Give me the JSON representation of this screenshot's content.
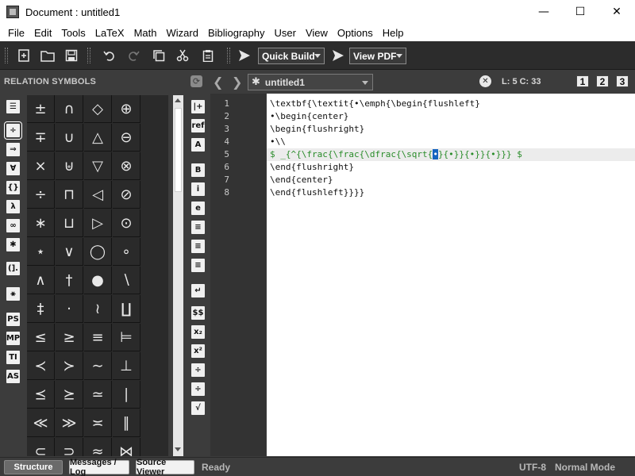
{
  "window": {
    "title": "Document : untitled1",
    "minimize": "—",
    "maximize": "☐",
    "close": "✕"
  },
  "menu": [
    "File",
    "Edit",
    "Tools",
    "LaTeX",
    "Math",
    "Wizard",
    "Bibliography",
    "User",
    "View",
    "Options",
    "Help"
  ],
  "toolbar": {
    "quick_build": "Quick Build",
    "view_pdf": "View PDF"
  },
  "panel": {
    "title": "RELATION SYMBOLS",
    "categories": [
      "☰",
      "÷",
      "⇒",
      "∀",
      "{}",
      "λ",
      "∞",
      "✱",
      "(].",
      "⚹",
      "PS",
      "MP",
      "TI",
      "AS"
    ]
  },
  "symbols": [
    [
      "±",
      "∩",
      "◇",
      "⊕"
    ],
    [
      "∓",
      "∪",
      "△",
      "⊖"
    ],
    [
      "×",
      "⊎",
      "▽",
      "⊗"
    ],
    [
      "÷",
      "⊓",
      "◁",
      "⊘"
    ],
    [
      "∗",
      "⊔",
      "▷",
      "⊙"
    ],
    [
      "⋆",
      "∨",
      "◯",
      "∘"
    ],
    [
      "∧",
      "†",
      "●",
      "∖"
    ],
    [
      "‡",
      "·",
      "≀",
      "∐"
    ],
    [
      "≤",
      "≥",
      "≡",
      "⊨"
    ],
    [
      "≺",
      "≻",
      "∼",
      "⊥"
    ],
    [
      "⪯",
      "⪰",
      "≃",
      "∣"
    ],
    [
      "≪",
      "≫",
      "≍",
      "∥"
    ],
    [
      "⊂",
      "⊃",
      "≈",
      "⋈"
    ]
  ],
  "format_bar": [
    "|+",
    "ref",
    "A",
    "B",
    "i",
    "e",
    "≡",
    "≡",
    "≡",
    "↵",
    "$$",
    "x₂",
    "x²",
    "÷",
    "÷",
    "√"
  ],
  "tab": {
    "star": "✱",
    "doc_name": "untitled1",
    "close": "✕",
    "cursor": "L: 5 C: 33",
    "views": [
      "1",
      "2",
      "3"
    ]
  },
  "editor": {
    "line_numbers": [
      "1",
      "2",
      "3",
      "4",
      "5",
      "6",
      "7",
      "8"
    ],
    "lines": [
      "\\textbf{\\textit{•\\emph{\\begin{flushleft}",
      "•\\begin{center}",
      "\\begin{flushright}",
      "•\\\\",
      "",
      "\\end{flushright}",
      "\\end{center}",
      "\\end{flushleft}}}}"
    ],
    "line5_pre": "$ _{^{\\frac{\\frac{\\dfrac{\\sqrt{",
    "line5_sel": "•",
    "line5_post": "}{•}}{•}}{•}}} $"
  },
  "status": {
    "structure": "Structure",
    "messages": "Messages / Log",
    "source_viewer": "Source Viewer",
    "ready": "Ready",
    "encoding": "UTF-8",
    "mode": "Normal Mode"
  }
}
